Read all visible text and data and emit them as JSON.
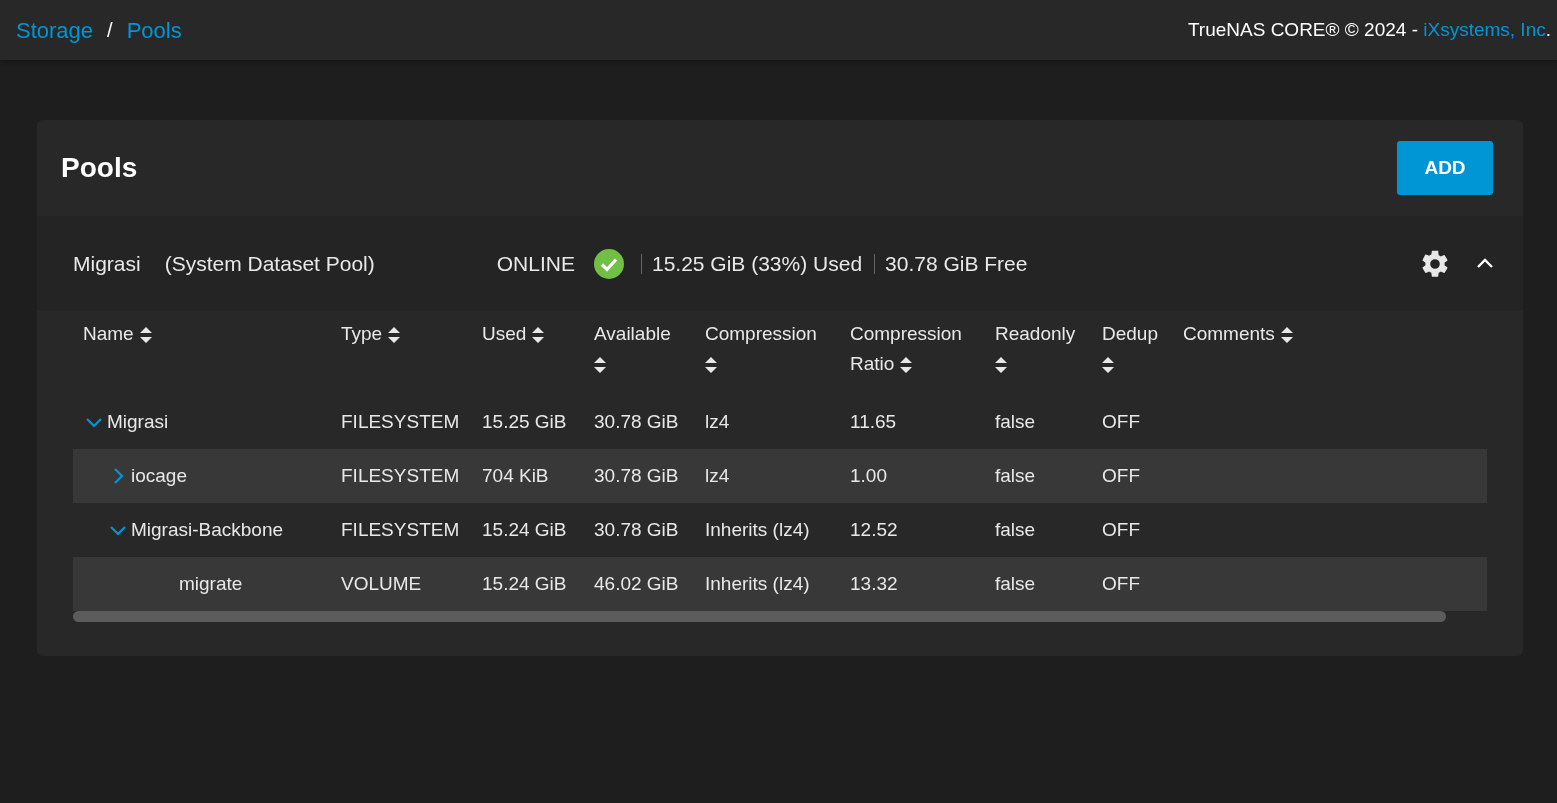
{
  "breadcrumb": [
    "Storage",
    "Pools"
  ],
  "breadcrumb_separator": "/",
  "copyright": {
    "text": "TrueNAS CORE® © 2024 - ",
    "link": "iXsystems, Inc",
    "suffix": "."
  },
  "card": {
    "title": "Pools",
    "add_button": "ADD"
  },
  "pool": {
    "name": "Migrasi",
    "subtitle": "(System Dataset Pool)",
    "status": "ONLINE",
    "healthy": true,
    "used": "15.25 GiB (33%) Used",
    "free": "30.78 GiB Free",
    "expanded": true
  },
  "table": {
    "columns": [
      {
        "label": "Name"
      },
      {
        "label": "Type"
      },
      {
        "label": "Used"
      },
      {
        "label": "Available"
      },
      {
        "label": "Compression"
      },
      {
        "label": "Compression Ratio"
      },
      {
        "label": "Readonly"
      },
      {
        "label": "Dedup"
      },
      {
        "label": "Comments"
      }
    ],
    "rows": [
      {
        "name": "Migrasi",
        "type": "FILESYSTEM",
        "used": "15.25 GiB",
        "available": "30.78 GiB",
        "compression": "lz4",
        "ratio": "11.65",
        "readonly": "false",
        "dedup": "OFF",
        "expanded": true,
        "children": [
          {
            "name": "iocage",
            "type": "FILESYSTEM",
            "used": "704 KiB",
            "available": "30.78 GiB",
            "compression": "lz4",
            "ratio": "1.00",
            "readonly": "false",
            "dedup": "OFF",
            "expanded": false
          },
          {
            "name": "Migrasi-Backbone",
            "type": "FILESYSTEM",
            "used": "15.24 GiB",
            "available": "30.78 GiB",
            "compression": "Inherits (lz4)",
            "ratio": "12.52",
            "readonly": "false",
            "dedup": "OFF",
            "expanded": true,
            "children": [
              {
                "name": "migrate",
                "type": "VOLUME",
                "used": "15.24 GiB",
                "available": "46.02 GiB",
                "compression": "Inherits (lz4)",
                "ratio": "13.32",
                "readonly": "false",
                "dedup": "OFF"
              }
            ]
          }
        ]
      }
    ]
  }
}
